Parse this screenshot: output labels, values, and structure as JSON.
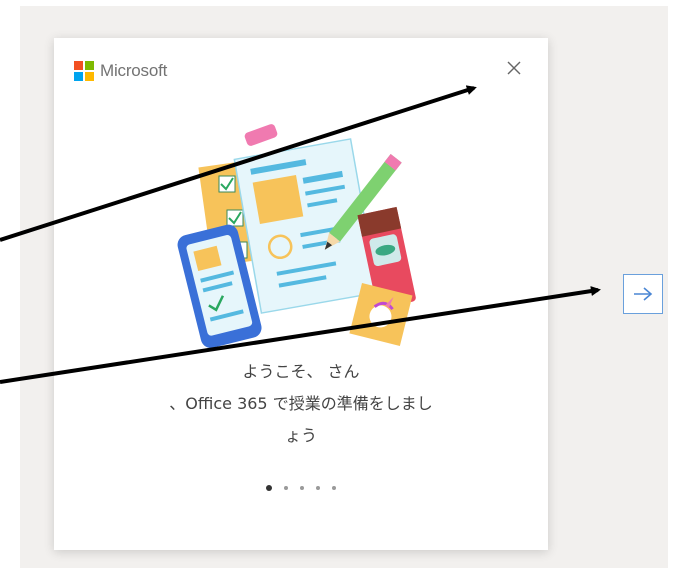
{
  "brand": {
    "name": "Microsoft"
  },
  "dialog": {
    "message_line1": "ようこそ、 さん",
    "message_line2": "、Office 365 で授業の準備をしまし",
    "message_line3": "ょう",
    "pagination": {
      "current": 1,
      "total": 5
    }
  },
  "colors": {
    "ms_red": "#f25022",
    "ms_green": "#7fba00",
    "ms_blue": "#00a4ef",
    "ms_yellow": "#ffb900",
    "next_border": "#6aa0dc"
  },
  "icons": {
    "close": "close-icon",
    "next": "arrow-right-icon"
  }
}
